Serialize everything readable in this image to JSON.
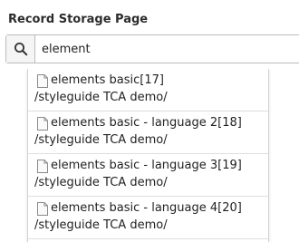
{
  "field": {
    "label": "Record Storage Page"
  },
  "search": {
    "value": "element",
    "icon": "search-icon"
  },
  "results": [
    {
      "title": "elements basic[17]",
      "path": "/styleguide TCA demo/",
      "icon": "file-icon"
    },
    {
      "title": "elements basic - language 2[18]",
      "path": "/styleguide TCA demo/",
      "icon": "file-icon"
    },
    {
      "title": "elements basic - language 3[19]",
      "path": "/styleguide TCA demo/",
      "icon": "file-icon"
    },
    {
      "title": "elements basic - language 4[20]",
      "path": "/styleguide TCA demo/",
      "icon": "file-icon"
    }
  ]
}
